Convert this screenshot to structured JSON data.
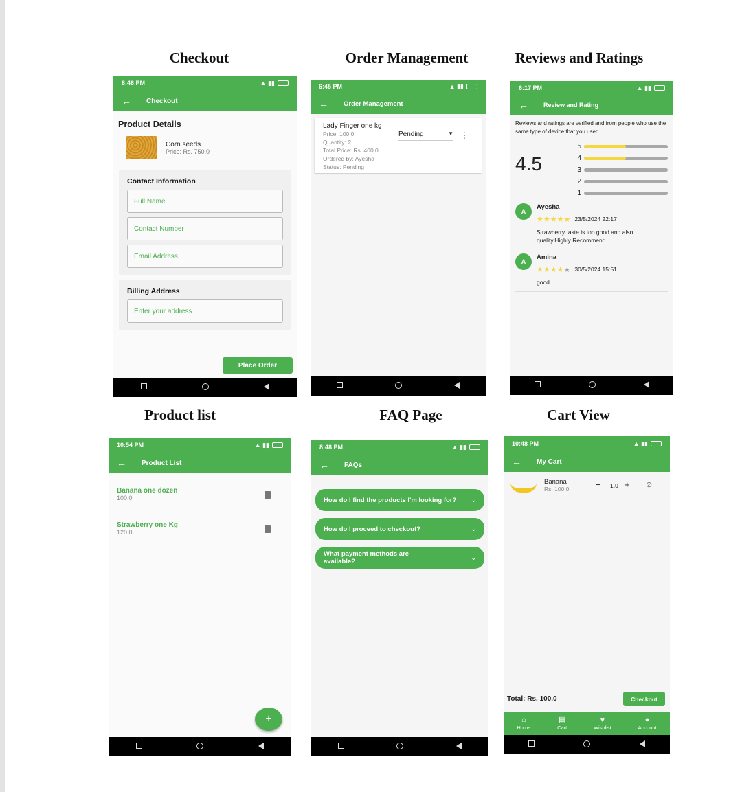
{
  "titles": {
    "checkout": "Checkout",
    "order_management": "Order Management",
    "reviews": "Reviews and Ratings",
    "product_list": "Product list",
    "faq": "FAQ Page",
    "cart": "Cart View"
  },
  "icons": {
    "back": "arrow-left-icon",
    "delete": "trash-icon",
    "dropdown": "caret-down-icon",
    "more": "more-vert-icon",
    "add": "plus-icon",
    "chevron": "chevron-down-icon",
    "remove_cart": "remove-shopping-cart-icon",
    "nav_recent": "square-icon",
    "nav_home": "circle-icon",
    "nav_back": "triangle-icon"
  },
  "colors": {
    "primary": "#4caf50",
    "star": "#f5d742",
    "navbar": "#000000"
  },
  "checkout": {
    "status_time": "8:48 PM",
    "appbar_title": "Checkout",
    "product_details_heading": "Product Details",
    "product_name": "Corn seeds",
    "product_price": "Price: Rs. 750.0",
    "contact_heading": "Contact Information",
    "full_name_placeholder": "Full Name",
    "contact_number_placeholder": "Contact Number",
    "email_placeholder": "Email Address",
    "billing_heading": "Billing Address",
    "address_placeholder": "Enter your address",
    "place_order_label": "Place Order"
  },
  "order_management": {
    "status_time": "6:45 PM",
    "appbar_title": "Order Management",
    "order": {
      "name": "Lady Finger one kg",
      "price": "Price: 100.0",
      "quantity": "Quantity: 2",
      "total": "Total Price: Rs. 400.0",
      "ordered_by": "Ordered by: Ayesha",
      "status": "Status: Pending",
      "status_select": "Pending"
    }
  },
  "reviews": {
    "status_time": "6:17 PM",
    "appbar_title": "Review and Rating",
    "intro": "Reviews and ratings are verified and from people who use the same type of device that you used.",
    "average": "4.5",
    "distribution": [
      {
        "label": "5",
        "fraction": 0.5
      },
      {
        "label": "4",
        "fraction": 0.5
      },
      {
        "label": "3",
        "fraction": 0
      },
      {
        "label": "2",
        "fraction": 0
      },
      {
        "label": "1",
        "fraction": 0
      }
    ],
    "items": [
      {
        "avatar": "A",
        "name": "Ayesha",
        "stars": 5,
        "date": "23/5/2024 22:17",
        "text": "Strawberry taste is too good and also quality.Highly Recommend"
      },
      {
        "avatar": "A",
        "name": "Amina",
        "stars": 4,
        "date": "30/5/2024 15:51",
        "text": "good"
      }
    ]
  },
  "product_list": {
    "status_time": "10:54 PM",
    "appbar_title": "Product List",
    "items": [
      {
        "name": "Banana one dozen",
        "price": "100.0"
      },
      {
        "name": "Strawberry one Kg",
        "price": "120.0"
      }
    ],
    "fab_label": "+"
  },
  "faq": {
    "status_time": "8:48 PM",
    "appbar_title": "FAQs",
    "questions": [
      "How do I find the products I'm looking for?",
      "How do I proceed to checkout?",
      "What payment methods are available?"
    ]
  },
  "cart": {
    "status_time": "10:48 PM",
    "appbar_title": "My Cart",
    "item": {
      "name": "Banana",
      "price": "Rs. 100.0",
      "quantity": "1.0"
    },
    "total": "Total: Rs. 100.0",
    "checkout_label": "Checkout",
    "tabs": [
      "Home",
      "Cart",
      "Wishlist",
      "Account"
    ]
  }
}
